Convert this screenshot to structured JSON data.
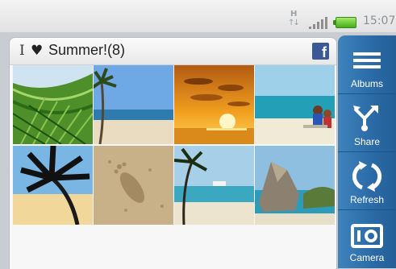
{
  "status_bar": {
    "network_letter": "H",
    "network_arrows": "↑↓",
    "time": "15:07"
  },
  "album": {
    "title": "Summer!(8)",
    "heart_glyph": "♥",
    "cursor_glyph": "I",
    "facebook_glyph": "f",
    "photos": [
      {
        "subject": "palm-leaves"
      },
      {
        "subject": "beach-palm"
      },
      {
        "subject": "sunset"
      },
      {
        "subject": "couple-on-beach"
      },
      {
        "subject": "palm-silhouette"
      },
      {
        "subject": "footprint-in-sand"
      },
      {
        "subject": "cruise-ship-beach"
      },
      {
        "subject": "rock-coast"
      }
    ]
  },
  "actions": [
    {
      "label": "Albums",
      "icon": "albums-icon"
    },
    {
      "label": "Share",
      "icon": "share-icon"
    },
    {
      "label": "Refresh",
      "icon": "refresh-icon"
    },
    {
      "label": "Camera",
      "icon": "camera-icon"
    }
  ],
  "colors": {
    "action_bar": "#2a6aa6",
    "facebook": "#3b5998",
    "battery": "#43b01b"
  }
}
